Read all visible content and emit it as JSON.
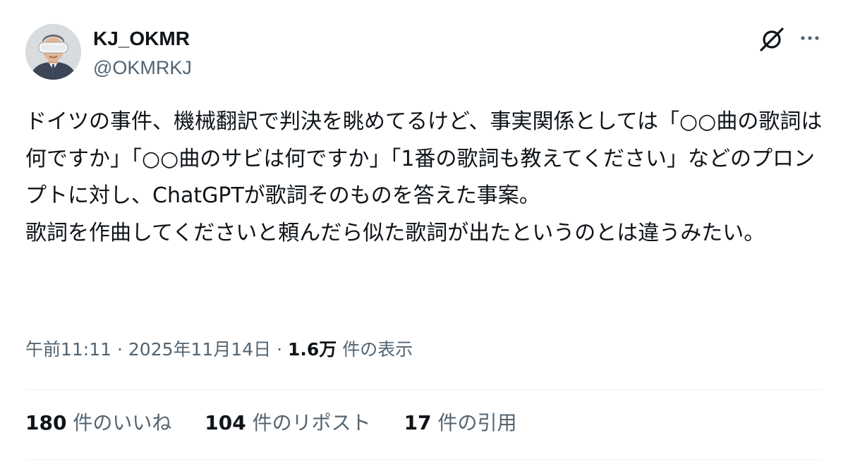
{
  "author": {
    "name": "KJ_OKMR",
    "handle": "@OKMRKJ",
    "avatar_icon": "avatar-vr-headset"
  },
  "header_icons": [
    "grok-icon",
    "more-icon"
  ],
  "tweet": {
    "paragraph_1": "ドイツの事件、機械翻訳で判決を眺めてるけど、事実関係としては「○○曲の歌詞は何ですか」「○○曲のサビは何ですか」「1番の歌詞も教えてください」などのプロンプトに対し、ChatGPTが歌詞そのものを答えた事案。",
    "paragraph_2": "歌詞を作曲してくださいと頼んだら似た歌詞が出たというのとは違うみたい。"
  },
  "meta": {
    "time": "午前11:11",
    "date": "2025年11月14日",
    "separator": "·",
    "views_count": "1.6万",
    "views_label": "件の表示"
  },
  "stats": {
    "likes_count": "180",
    "likes_label": "件のいいね",
    "reposts_count": "104",
    "reposts_label": "件のリポスト",
    "quotes_count": "17",
    "quotes_label": "件の引用"
  },
  "colors": {
    "text_primary": "#0f1419",
    "text_secondary": "#536471",
    "divider": "#eff3f4"
  }
}
